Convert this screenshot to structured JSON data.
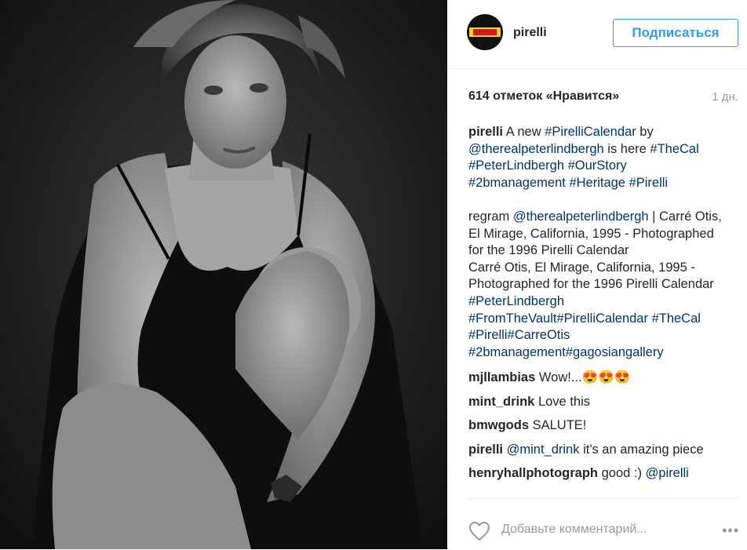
{
  "post": {
    "username": "pirelli",
    "follow_label": "Подписаться",
    "likes_text": "614 отметок «Нравится»",
    "time_ago": "1 дн.",
    "caption": {
      "user": "pirelli",
      "l1_text": " A new ",
      "l1_tag1": "#PirelliCalendar",
      "l1_by": " by",
      "l2_mention": "@therealpeterlindbergh",
      "l2_text": " is here ",
      "l2_tag": "#TheCal",
      "l3_tag1": "#PeterLindbergh",
      "l3_tag2": "#OurStory",
      "l4_tag1": "#2bmanagement",
      "l4_tag2": "#Heritage",
      "l4_tag3": "#Pirelli",
      "p2_regram": "regram ",
      "p2_mention": "@therealpeterlindbergh",
      "p2_rest1": " | Carré Otis,",
      "p2_line2": "El Mirage, California, 1995 - Photographed",
      "p2_line3": "for the 1996 Pirelli Calendar",
      "p2_line4": "Carré Otis, El Mirage, California, 1995 -",
      "p2_line5": "Photographed for the 1996 Pirelli Calendar",
      "p2_tag1": "#PeterLindbergh",
      "p2_tag2": "#FromTheVault",
      "p2_tag3": "#PirelliCalendar",
      "p2_tag4": "#TheCal",
      "p2_tag5": "#Pirelli",
      "p2_tag6": "#CarreOtis",
      "p2_tag7": "#2bmanagement",
      "p2_tag8": "#gagosiangallery"
    },
    "comments": [
      {
        "user": "mjllambias",
        "text": "Wow!...😍😍😍"
      },
      {
        "user": "mint_drink",
        "text": "Love this"
      },
      {
        "user": "bmwgods",
        "text": "SALUTE!"
      },
      {
        "user": "pirelli",
        "mention": "@mint_drink",
        "text": " it's an amazing piece"
      },
      {
        "user": "henryhallphotograph",
        "text": "good :) ",
        "mention": "@pirelli"
      }
    ],
    "add_comment_placeholder": "Добавьте комментарий...",
    "more_icon": "•••",
    "icons": {
      "like": "heart-icon",
      "more": "more-options-icon"
    },
    "colors": {
      "link": "#003569",
      "button": "#3897f0",
      "muted": "#999999"
    }
  }
}
